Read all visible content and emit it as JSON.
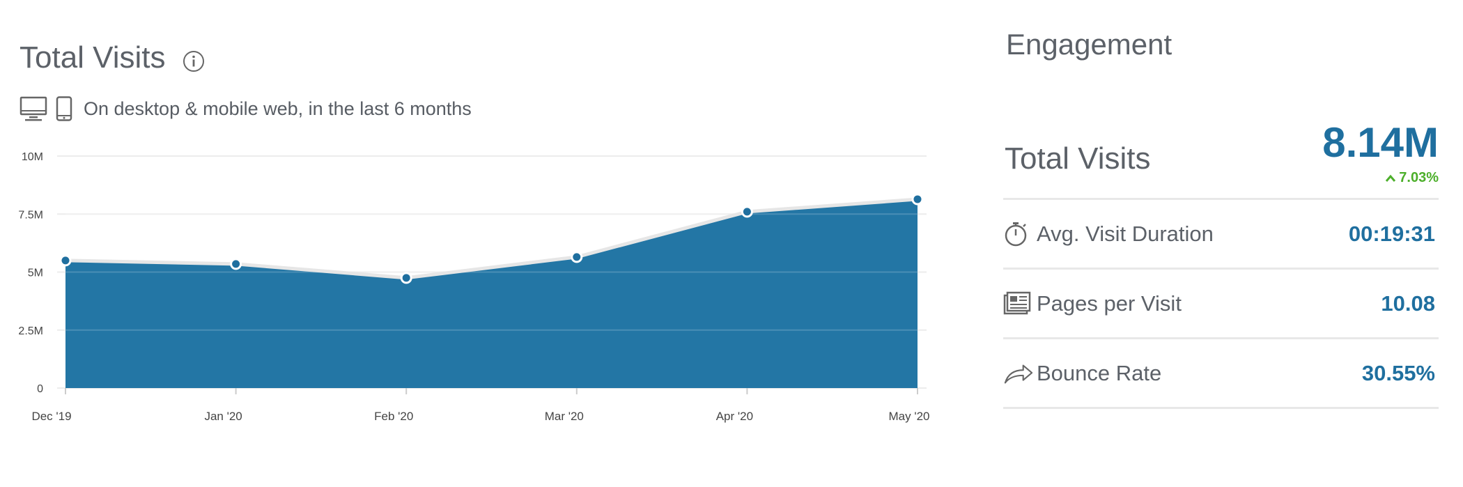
{
  "total_visits_card": {
    "title": "Total Visits",
    "info_icon": "info-icon",
    "device_icons": [
      "desktop-icon",
      "mobile-icon"
    ],
    "subtitle": "On desktop & mobile web, in the last 6 months"
  },
  "chart_data": {
    "type": "area",
    "categories": [
      "Dec '19",
      "Jan '20",
      "Feb '20",
      "Mar '20",
      "Apr '20",
      "May '20"
    ],
    "values": [
      5.5,
      5.35,
      4.75,
      5.65,
      7.6,
      8.14
    ],
    "y_ticks": [
      "0",
      "2.5M",
      "5M",
      "7.5M",
      "10M"
    ],
    "ylim": [
      0,
      10
    ],
    "unit": "M",
    "grid": true,
    "colors": {
      "fill": "#2376a5",
      "line": "#e6e6e6",
      "marker": "#1f6f9f",
      "grid": "#ececec"
    }
  },
  "engagement": {
    "title": "Engagement",
    "total_visits_label": "Total Visits",
    "total_visits_value": "8.14M",
    "total_visits_change": "7.03%",
    "change_direction": "up",
    "metrics": [
      {
        "icon": "stopwatch-icon",
        "label": "Avg. Visit Duration",
        "value": "00:19:31"
      },
      {
        "icon": "pages-icon",
        "label": "Pages per Visit",
        "value": "10.08"
      },
      {
        "icon": "bounce-arrow-icon",
        "label": "Bounce Rate",
        "value": "30.55%"
      }
    ],
    "colors": {
      "value": "#1f6f9f",
      "positive": "#4caf2a"
    }
  }
}
